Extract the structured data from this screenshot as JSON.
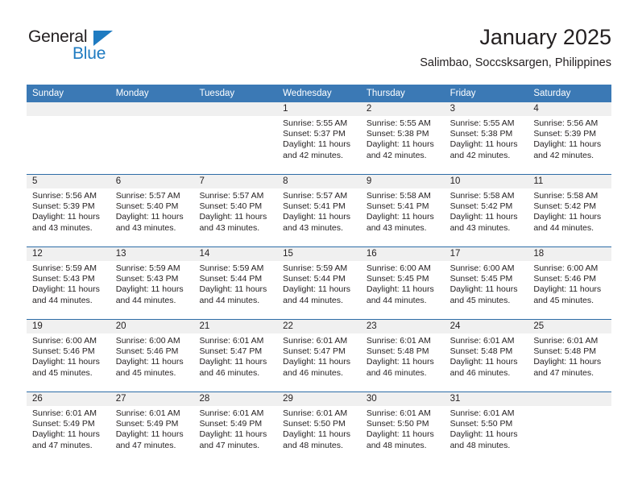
{
  "brand": {
    "name_top": "General",
    "name_bottom": "Blue",
    "triangle_color": "#1f7bc1"
  },
  "header": {
    "title": "January 2025",
    "subtitle": "Salimbao, Soccsksargen, Philippines"
  },
  "theme": {
    "header_bg": "#3b79b5",
    "week_rule": "#2d6ca6",
    "daynum_bg": "#f0f0f0",
    "text": "#231f20"
  },
  "weekdays": [
    "Sunday",
    "Monday",
    "Tuesday",
    "Wednesday",
    "Thursday",
    "Friday",
    "Saturday"
  ],
  "weeks": [
    [
      {
        "day": "",
        "lines": []
      },
      {
        "day": "",
        "lines": []
      },
      {
        "day": "",
        "lines": []
      },
      {
        "day": "1",
        "lines": [
          "Sunrise: 5:55 AM",
          "Sunset: 5:37 PM",
          "Daylight: 11 hours",
          "and 42 minutes."
        ]
      },
      {
        "day": "2",
        "lines": [
          "Sunrise: 5:55 AM",
          "Sunset: 5:38 PM",
          "Daylight: 11 hours",
          "and 42 minutes."
        ]
      },
      {
        "day": "3",
        "lines": [
          "Sunrise: 5:55 AM",
          "Sunset: 5:38 PM",
          "Daylight: 11 hours",
          "and 42 minutes."
        ]
      },
      {
        "day": "4",
        "lines": [
          "Sunrise: 5:56 AM",
          "Sunset: 5:39 PM",
          "Daylight: 11 hours",
          "and 42 minutes."
        ]
      }
    ],
    [
      {
        "day": "5",
        "lines": [
          "Sunrise: 5:56 AM",
          "Sunset: 5:39 PM",
          "Daylight: 11 hours",
          "and 43 minutes."
        ]
      },
      {
        "day": "6",
        "lines": [
          "Sunrise: 5:57 AM",
          "Sunset: 5:40 PM",
          "Daylight: 11 hours",
          "and 43 minutes."
        ]
      },
      {
        "day": "7",
        "lines": [
          "Sunrise: 5:57 AM",
          "Sunset: 5:40 PM",
          "Daylight: 11 hours",
          "and 43 minutes."
        ]
      },
      {
        "day": "8",
        "lines": [
          "Sunrise: 5:57 AM",
          "Sunset: 5:41 PM",
          "Daylight: 11 hours",
          "and 43 minutes."
        ]
      },
      {
        "day": "9",
        "lines": [
          "Sunrise: 5:58 AM",
          "Sunset: 5:41 PM",
          "Daylight: 11 hours",
          "and 43 minutes."
        ]
      },
      {
        "day": "10",
        "lines": [
          "Sunrise: 5:58 AM",
          "Sunset: 5:42 PM",
          "Daylight: 11 hours",
          "and 43 minutes."
        ]
      },
      {
        "day": "11",
        "lines": [
          "Sunrise: 5:58 AM",
          "Sunset: 5:42 PM",
          "Daylight: 11 hours",
          "and 44 minutes."
        ]
      }
    ],
    [
      {
        "day": "12",
        "lines": [
          "Sunrise: 5:59 AM",
          "Sunset: 5:43 PM",
          "Daylight: 11 hours",
          "and 44 minutes."
        ]
      },
      {
        "day": "13",
        "lines": [
          "Sunrise: 5:59 AM",
          "Sunset: 5:43 PM",
          "Daylight: 11 hours",
          "and 44 minutes."
        ]
      },
      {
        "day": "14",
        "lines": [
          "Sunrise: 5:59 AM",
          "Sunset: 5:44 PM",
          "Daylight: 11 hours",
          "and 44 minutes."
        ]
      },
      {
        "day": "15",
        "lines": [
          "Sunrise: 5:59 AM",
          "Sunset: 5:44 PM",
          "Daylight: 11 hours",
          "and 44 minutes."
        ]
      },
      {
        "day": "16",
        "lines": [
          "Sunrise: 6:00 AM",
          "Sunset: 5:45 PM",
          "Daylight: 11 hours",
          "and 44 minutes."
        ]
      },
      {
        "day": "17",
        "lines": [
          "Sunrise: 6:00 AM",
          "Sunset: 5:45 PM",
          "Daylight: 11 hours",
          "and 45 minutes."
        ]
      },
      {
        "day": "18",
        "lines": [
          "Sunrise: 6:00 AM",
          "Sunset: 5:46 PM",
          "Daylight: 11 hours",
          "and 45 minutes."
        ]
      }
    ],
    [
      {
        "day": "19",
        "lines": [
          "Sunrise: 6:00 AM",
          "Sunset: 5:46 PM",
          "Daylight: 11 hours",
          "and 45 minutes."
        ]
      },
      {
        "day": "20",
        "lines": [
          "Sunrise: 6:00 AM",
          "Sunset: 5:46 PM",
          "Daylight: 11 hours",
          "and 45 minutes."
        ]
      },
      {
        "day": "21",
        "lines": [
          "Sunrise: 6:01 AM",
          "Sunset: 5:47 PM",
          "Daylight: 11 hours",
          "and 46 minutes."
        ]
      },
      {
        "day": "22",
        "lines": [
          "Sunrise: 6:01 AM",
          "Sunset: 5:47 PM",
          "Daylight: 11 hours",
          "and 46 minutes."
        ]
      },
      {
        "day": "23",
        "lines": [
          "Sunrise: 6:01 AM",
          "Sunset: 5:48 PM",
          "Daylight: 11 hours",
          "and 46 minutes."
        ]
      },
      {
        "day": "24",
        "lines": [
          "Sunrise: 6:01 AM",
          "Sunset: 5:48 PM",
          "Daylight: 11 hours",
          "and 46 minutes."
        ]
      },
      {
        "day": "25",
        "lines": [
          "Sunrise: 6:01 AM",
          "Sunset: 5:48 PM",
          "Daylight: 11 hours",
          "and 47 minutes."
        ]
      }
    ],
    [
      {
        "day": "26",
        "lines": [
          "Sunrise: 6:01 AM",
          "Sunset: 5:49 PM",
          "Daylight: 11 hours",
          "and 47 minutes."
        ]
      },
      {
        "day": "27",
        "lines": [
          "Sunrise: 6:01 AM",
          "Sunset: 5:49 PM",
          "Daylight: 11 hours",
          "and 47 minutes."
        ]
      },
      {
        "day": "28",
        "lines": [
          "Sunrise: 6:01 AM",
          "Sunset: 5:49 PM",
          "Daylight: 11 hours",
          "and 47 minutes."
        ]
      },
      {
        "day": "29",
        "lines": [
          "Sunrise: 6:01 AM",
          "Sunset: 5:50 PM",
          "Daylight: 11 hours",
          "and 48 minutes."
        ]
      },
      {
        "day": "30",
        "lines": [
          "Sunrise: 6:01 AM",
          "Sunset: 5:50 PM",
          "Daylight: 11 hours",
          "and 48 minutes."
        ]
      },
      {
        "day": "31",
        "lines": [
          "Sunrise: 6:01 AM",
          "Sunset: 5:50 PM",
          "Daylight: 11 hours",
          "and 48 minutes."
        ]
      },
      {
        "day": "",
        "lines": []
      }
    ]
  ]
}
